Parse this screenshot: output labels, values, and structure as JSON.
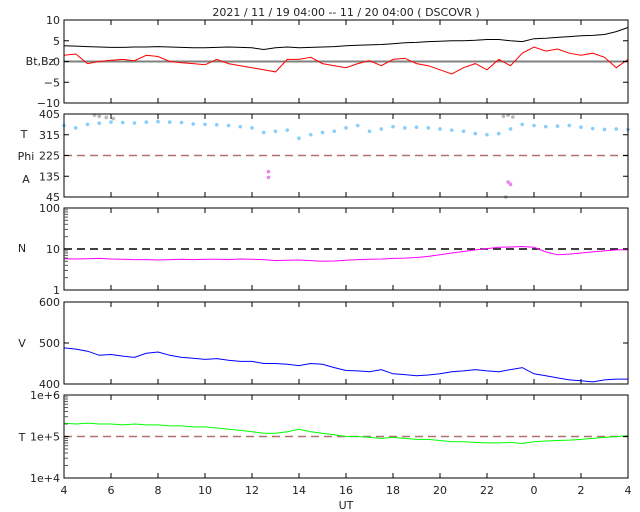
{
  "chart_data": {
    "type": "line",
    "title": "2021 / 11 / 19   04:00 -- 11 / 20   04:00 ( DSCOVR )",
    "xlabel": "UT",
    "x_start_hour": 4,
    "x_step_hours": 0.5,
    "xlim": [
      4,
      28
    ],
    "x_ticks": [
      4,
      6,
      8,
      10,
      12,
      14,
      16,
      18,
      20,
      22,
      24,
      26,
      28
    ],
    "x_tick_labels": [
      "4",
      "6",
      "8",
      "10",
      "12",
      "14",
      "16",
      "18",
      "20",
      "22",
      "0",
      "2",
      "4"
    ],
    "panels": [
      {
        "ylabel": "Bt,Bz",
        "scale": "linear",
        "ylim": [
          -10,
          10
        ],
        "yticks": [
          10,
          5,
          0,
          -5,
          -10
        ],
        "ytick_labels": [
          "10",
          "5",
          "0",
          "−5",
          "−10"
        ],
        "reference": {
          "value": 0,
          "color": "#808080",
          "style": "solid"
        },
        "series": [
          {
            "name": "Bt",
            "color": "#000000",
            "values": [
              3.8,
              3.7,
              3.6,
              3.5,
              3.4,
              3.4,
              3.5,
              3.5,
              3.6,
              3.5,
              3.4,
              3.3,
              3.3,
              3.4,
              3.5,
              3.4,
              3.3,
              2.9,
              3.3,
              3.5,
              3.3,
              3.4,
              3.5,
              3.6,
              3.8,
              3.9,
              4.0,
              4.1,
              4.3,
              4.5,
              4.6,
              4.8,
              4.9,
              5.0,
              5.0,
              5.1,
              5.3,
              5.3,
              5.0,
              4.8,
              5.5,
              5.6,
              5.8,
              6.0,
              6.2,
              6.3,
              6.5,
              7.2,
              8.2
            ]
          },
          {
            "name": "Bz",
            "color": "#ff0000",
            "values": [
              1.5,
              1.8,
              -0.5,
              0,
              0.3,
              0.5,
              0.2,
              1.5,
              1.2,
              0,
              -0.3,
              -0.5,
              -0.8,
              0.5,
              -0.5,
              -1.0,
              -1.5,
              -2.0,
              -2.5,
              0.5,
              0.5,
              1.0,
              -0.5,
              -1.0,
              -1.5,
              -0.5,
              0.2,
              -1.0,
              0.5,
              0.8,
              -0.5,
              -1.0,
              -2.0,
              -3.0,
              -1.5,
              -0.5,
              -2.0,
              0.5,
              -1.0,
              2.0,
              3.5,
              2.5,
              3.0,
              2.0,
              1.5,
              2.0,
              1.0,
              -1.5,
              0.5
            ]
          }
        ]
      },
      {
        "ylabel_lines": [
          "T",
          "Phi",
          "A"
        ],
        "scale": "linear",
        "ylim": [
          45,
          405
        ],
        "yticks": [
          405,
          315,
          225,
          135,
          45
        ],
        "ytick_labels": [
          "405",
          "315",
          "225",
          "135",
          "45"
        ],
        "reference": {
          "value": 225,
          "color": "#b07070",
          "style": "dashed"
        },
        "series": [
          {
            "name": "Phi",
            "color": "#87cefa",
            "marker": "dot",
            "values": [
              355,
              345,
              360,
              365,
              370,
              368,
              366,
              370,
              372,
              370,
              368,
              362,
              360,
              358,
              355,
              350,
              345,
              325,
              330,
              335,
              300,
              315,
              325,
              330,
              345,
              355,
              330,
              340,
              350,
              345,
              348,
              345,
              340,
              335,
              330,
              320,
              315,
              320,
              340,
              360,
              355,
              350,
              352,
              355,
              348,
              342,
              338,
              340,
              338
            ]
          },
          {
            "name": "Phi-gray",
            "color": "#b8b8b8",
            "marker": "dot",
            "points": [
              [
                5.3,
                400
              ],
              [
                5.5,
                395
              ],
              [
                5.8,
                390
              ],
              [
                6.1,
                385
              ],
              [
                22.7,
                395
              ],
              [
                22.9,
                400
              ],
              [
                23.1,
                392
              ],
              [
                22.8,
                45
              ]
            ]
          },
          {
            "name": "Phi-magenta",
            "color": "#ee82ee",
            "marker": "dot",
            "points": [
              [
                12.7,
                155
              ],
              [
                12.7,
                130
              ],
              [
                22.9,
                110
              ],
              [
                23.0,
                100
              ]
            ]
          }
        ]
      },
      {
        "ylabel": "N",
        "scale": "log",
        "ylim": [
          1,
          100
        ],
        "yticks": [
          100,
          10,
          1
        ],
        "ytick_labels": [
          "100",
          "10",
          "1"
        ],
        "reference": {
          "value": 10,
          "color": "#000000",
          "style": "dashed"
        },
        "series": [
          {
            "name": "N",
            "color": "#ff00ff",
            "values": [
              5.8,
              5.7,
              5.8,
              5.9,
              5.7,
              5.6,
              5.5,
              5.5,
              5.4,
              5.5,
              5.6,
              5.5,
              5.6,
              5.6,
              5.5,
              5.7,
              5.6,
              5.5,
              5.2,
              5.3,
              5.4,
              5.2,
              5.0,
              5.1,
              5.3,
              5.5,
              5.6,
              5.7,
              5.9,
              6.0,
              6.2,
              6.6,
              7.2,
              8.0,
              8.7,
              9.5,
              10.2,
              11.0,
              11.2,
              11.5,
              11,
              8.5,
              7.2,
              7.5,
              8.0,
              8.5,
              9.0,
              9.5,
              9.6
            ]
          }
        ]
      },
      {
        "ylabel": "V",
        "scale": "linear",
        "ylim": [
          400,
          600
        ],
        "yticks": [
          600,
          500,
          400
        ],
        "ytick_labels": [
          "600",
          "500",
          "400"
        ],
        "series": [
          {
            "name": "V",
            "color": "#0000ff",
            "values": [
              488,
              485,
              480,
              470,
              472,
              468,
              465,
              475,
              478,
              470,
              465,
              463,
              460,
              462,
              458,
              455,
              455,
              450,
              450,
              448,
              445,
              450,
              448,
              440,
              433,
              432,
              430,
              435,
              425,
              423,
              420,
              422,
              425,
              430,
              432,
              435,
              432,
              430,
              435,
              440,
              425,
              420,
              415,
              410,
              408,
              405,
              410,
              412,
              412
            ]
          }
        ]
      },
      {
        "ylabel": "T",
        "scale": "log",
        "ylim": [
          10000,
          1000000
        ],
        "yticks": [
          1000000,
          100000,
          10000
        ],
        "ytick_labels": [
          "1e+6",
          "1e+5",
          "1e+4"
        ],
        "reference": {
          "value": 100000,
          "color": "#b07070",
          "style": "dashed"
        },
        "series": [
          {
            "name": "T",
            "color": "#00ff00",
            "values": [
              210000,
              200000,
              210000,
              200000,
              200000,
              190000,
              200000,
              190000,
              190000,
              180000,
              180000,
              170000,
              170000,
              160000,
              150000,
              140000,
              130000,
              120000,
              120000,
              130000,
              150000,
              130000,
              120000,
              110000,
              100000,
              100000,
              95000,
              90000,
              95000,
              90000,
              85000,
              85000,
              80000,
              75000,
              75000,
              72000,
              70000,
              70000,
              72000,
              68000,
              75000,
              78000,
              80000,
              82000,
              85000,
              90000,
              95000,
              100000,
              105000
            ]
          }
        ]
      }
    ]
  }
}
